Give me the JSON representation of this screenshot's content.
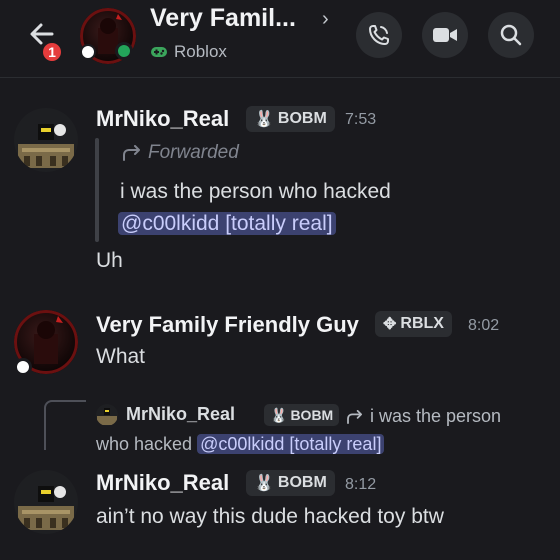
{
  "header": {
    "back_badge_count": "1",
    "title": "Very Famil...",
    "subtitle": "Roblox",
    "buttons": [
      "call-icon",
      "video-icon",
      "search-icon"
    ]
  },
  "messages": [
    {
      "author": "MrNiko_Real",
      "tag": "BOBM",
      "tag_icon": "bunny-icon",
      "time": "7:53",
      "forwarded_label": "Forwarded",
      "forwarded_line1": "i was the person who hacked",
      "forwarded_mention": "@c00lkidd [totally real]",
      "text": "Uh"
    },
    {
      "author": "Very Family Friendly Guy",
      "tag": "RBLX",
      "tag_icon": "diamond-icon",
      "time": "8:02",
      "text": "What"
    },
    {
      "reply_to_author": "MrNiko_Real",
      "reply_to_tag": "BOBM",
      "reply_to_text_start": "i was the person",
      "reply_to_text_cont": "who hacked",
      "reply_to_mention": "@c00lkidd [totally real]",
      "author": "MrNiko_Real",
      "tag": "BOBM",
      "tag_icon": "bunny-icon",
      "time": "8:12",
      "text": "ain’t no way this dude hacked toy btw"
    }
  ],
  "colors": {
    "background": "#1a1a1e",
    "mention_bg": "#3c4270",
    "online_status": "#23a55a",
    "badge_red": "#e53c3c"
  }
}
